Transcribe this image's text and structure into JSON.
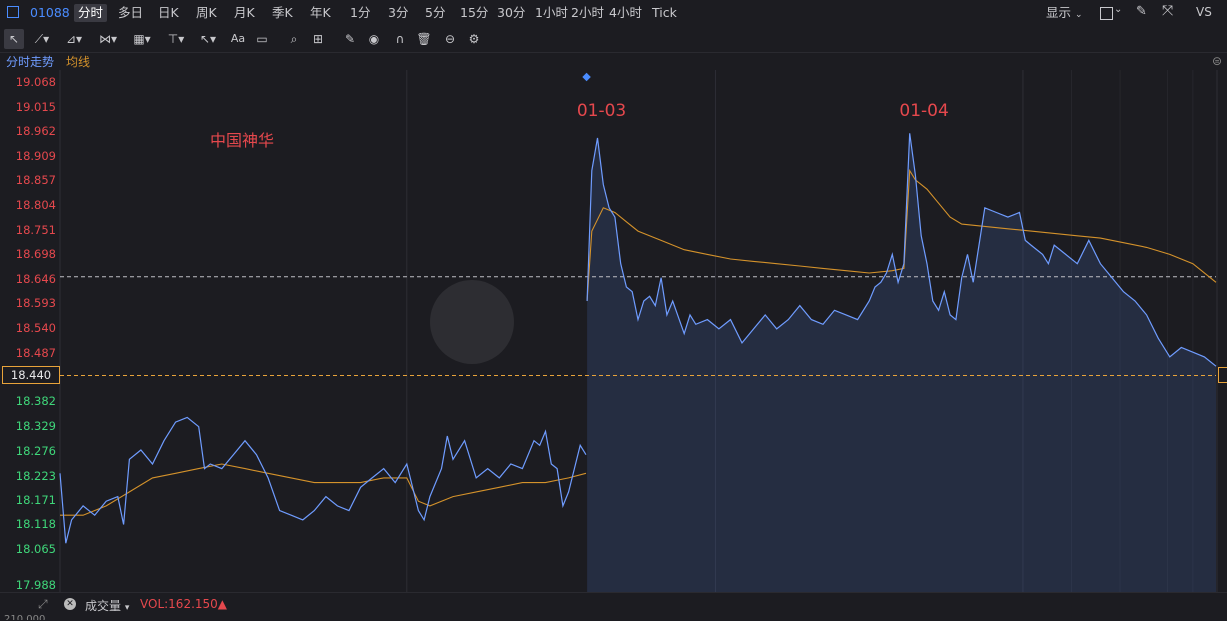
{
  "header": {
    "symbol": "01088",
    "tabs": [
      "分时",
      "多日",
      "日K",
      "周K",
      "月K",
      "季K",
      "年K",
      "1分",
      "3分",
      "5分",
      "15分",
      "30分",
      "1小时",
      "2小时",
      "4小时",
      "Tick"
    ],
    "active_tab": "分时",
    "display_label": "显示",
    "right_code": "VS"
  },
  "legend": {
    "series1": "分时走势",
    "series2": "均线"
  },
  "bottom": {
    "indicator": "成交量",
    "vol_text": "VOL:162.150▲",
    "bottom_cut_value": "210,000"
  },
  "colors": {
    "up": "#e5484d",
    "down": "#3fd77a",
    "price_line": "#6f9cff",
    "avg_line": "#d4922b",
    "accent": "#4a8cff",
    "current": "#e8a33a"
  },
  "chart_data": {
    "type": "line",
    "title": "中国神华",
    "ylim": [
      17.988,
      19.068
    ],
    "y_ticks": [
      19.068,
      19.015,
      18.962,
      18.909,
      18.857,
      18.804,
      18.751,
      18.698,
      18.646,
      18.593,
      18.54,
      18.487,
      18.44,
      18.382,
      18.329,
      18.276,
      18.223,
      18.171,
      18.118,
      18.065,
      17.988
    ],
    "y_tick_labels": [
      "19.068",
      "19.015",
      "18.962",
      "18.909",
      "18.857",
      "18.804",
      "18.751",
      "18.698",
      "18.646",
      "18.593",
      "18.540",
      "18.487",
      "18.440",
      "18.382",
      "18.329",
      "18.276",
      "18.223",
      "18.171",
      "18.118",
      "18.065",
      "17.988"
    ],
    "prev_close": 18.44,
    "prev_close_label": "18.440",
    "reference_line": 18.652,
    "day_labels": [
      "01-03",
      "01-04"
    ],
    "day_boundaries": [
      0.3,
      0.567,
      0.833
    ],
    "series": [
      {
        "name": "分时走势",
        "points": [
          [
            0,
            18.23
          ],
          [
            0.005,
            18.08
          ],
          [
            0.01,
            18.13
          ],
          [
            0.02,
            18.16
          ],
          [
            0.03,
            18.14
          ],
          [
            0.04,
            18.17
          ],
          [
            0.05,
            18.18
          ],
          [
            0.055,
            18.12
          ],
          [
            0.06,
            18.26
          ],
          [
            0.07,
            18.28
          ],
          [
            0.08,
            18.25
          ],
          [
            0.09,
            18.3
          ],
          [
            0.1,
            18.34
          ],
          [
            0.11,
            18.35
          ],
          [
            0.12,
            18.33
          ],
          [
            0.125,
            18.24
          ],
          [
            0.13,
            18.25
          ],
          [
            0.14,
            18.24
          ],
          [
            0.15,
            18.27
          ],
          [
            0.16,
            18.3
          ],
          [
            0.17,
            18.27
          ],
          [
            0.18,
            18.22
          ],
          [
            0.19,
            18.15
          ],
          [
            0.2,
            18.14
          ],
          [
            0.21,
            18.13
          ],
          [
            0.22,
            18.15
          ],
          [
            0.23,
            18.18
          ],
          [
            0.24,
            18.16
          ],
          [
            0.25,
            18.15
          ],
          [
            0.26,
            18.2
          ],
          [
            0.27,
            18.22
          ],
          [
            0.28,
            18.24
          ],
          [
            0.29,
            18.21
          ],
          [
            0.3,
            18.25
          ],
          [
            0.31,
            18.15
          ],
          [
            0.315,
            18.13
          ],
          [
            0.32,
            18.18
          ],
          [
            0.33,
            18.24
          ],
          [
            0.335,
            18.31
          ],
          [
            0.34,
            18.26
          ],
          [
            0.35,
            18.3
          ],
          [
            0.36,
            18.22
          ],
          [
            0.37,
            18.24
          ],
          [
            0.38,
            18.22
          ],
          [
            0.39,
            18.25
          ],
          [
            0.4,
            18.24
          ],
          [
            0.41,
            18.3
          ],
          [
            0.415,
            18.29
          ],
          [
            0.42,
            18.32
          ],
          [
            0.425,
            18.25
          ],
          [
            0.43,
            18.24
          ],
          [
            0.435,
            18.16
          ],
          [
            0.44,
            18.19
          ],
          [
            0.445,
            18.24
          ],
          [
            0.45,
            18.29
          ],
          [
            0.455,
            18.27
          ],
          [
            0.456,
            18.6
          ],
          [
            0.46,
            18.88
          ],
          [
            0.465,
            18.95
          ],
          [
            0.47,
            18.85
          ],
          [
            0.475,
            18.8
          ],
          [
            0.48,
            18.78
          ],
          [
            0.485,
            18.68
          ],
          [
            0.49,
            18.63
          ],
          [
            0.495,
            18.62
          ],
          [
            0.5,
            18.56
          ],
          [
            0.505,
            18.6
          ],
          [
            0.51,
            18.61
          ],
          [
            0.515,
            18.59
          ],
          [
            0.52,
            18.65
          ],
          [
            0.525,
            18.57
          ],
          [
            0.53,
            18.6
          ],
          [
            0.54,
            18.53
          ],
          [
            0.545,
            18.57
          ],
          [
            0.55,
            18.55
          ],
          [
            0.56,
            18.56
          ],
          [
            0.57,
            18.54
          ],
          [
            0.58,
            18.56
          ],
          [
            0.59,
            18.51
          ],
          [
            0.6,
            18.54
          ],
          [
            0.61,
            18.57
          ],
          [
            0.62,
            18.54
          ],
          [
            0.63,
            18.56
          ],
          [
            0.64,
            18.59
          ],
          [
            0.65,
            18.56
          ],
          [
            0.66,
            18.55
          ],
          [
            0.67,
            18.58
          ],
          [
            0.68,
            18.57
          ],
          [
            0.69,
            18.56
          ],
          [
            0.7,
            18.6
          ],
          [
            0.705,
            18.63
          ],
          [
            0.71,
            18.64
          ],
          [
            0.715,
            18.66
          ],
          [
            0.72,
            18.7
          ],
          [
            0.725,
            18.64
          ],
          [
            0.73,
            18.68
          ],
          [
            0.735,
            18.96
          ],
          [
            0.74,
            18.87
          ],
          [
            0.745,
            18.74
          ],
          [
            0.75,
            18.68
          ],
          [
            0.755,
            18.6
          ],
          [
            0.76,
            18.58
          ],
          [
            0.765,
            18.62
          ],
          [
            0.77,
            18.57
          ],
          [
            0.775,
            18.56
          ],
          [
            0.78,
            18.65
          ],
          [
            0.785,
            18.7
          ],
          [
            0.79,
            18.64
          ],
          [
            0.795,
            18.72
          ],
          [
            0.8,
            18.8
          ],
          [
            0.81,
            18.79
          ],
          [
            0.82,
            18.78
          ],
          [
            0.83,
            18.79
          ],
          [
            0.835,
            18.73
          ],
          [
            0.84,
            18.72
          ],
          [
            0.85,
            18.7
          ],
          [
            0.855,
            18.68
          ],
          [
            0.86,
            18.72
          ],
          [
            0.87,
            18.7
          ],
          [
            0.88,
            18.68
          ],
          [
            0.89,
            18.73
          ],
          [
            0.9,
            18.68
          ],
          [
            0.91,
            18.65
          ],
          [
            0.92,
            18.62
          ],
          [
            0.93,
            18.6
          ],
          [
            0.94,
            18.57
          ],
          [
            0.95,
            18.52
          ],
          [
            0.96,
            18.48
          ],
          [
            0.97,
            18.5
          ],
          [
            0.98,
            18.49
          ],
          [
            0.99,
            18.48
          ],
          [
            1.0,
            18.46
          ]
        ]
      },
      {
        "name": "均线",
        "points": [
          [
            0,
            18.14
          ],
          [
            0.02,
            18.14
          ],
          [
            0.04,
            18.16
          ],
          [
            0.06,
            18.19
          ],
          [
            0.08,
            18.22
          ],
          [
            0.1,
            18.23
          ],
          [
            0.12,
            18.24
          ],
          [
            0.14,
            18.25
          ],
          [
            0.16,
            18.24
          ],
          [
            0.18,
            18.23
          ],
          [
            0.2,
            18.22
          ],
          [
            0.22,
            18.21
          ],
          [
            0.24,
            18.21
          ],
          [
            0.26,
            18.21
          ],
          [
            0.28,
            18.22
          ],
          [
            0.3,
            18.22
          ],
          [
            0.31,
            18.17
          ],
          [
            0.32,
            18.16
          ],
          [
            0.34,
            18.18
          ],
          [
            0.36,
            18.19
          ],
          [
            0.38,
            18.2
          ],
          [
            0.4,
            18.21
          ],
          [
            0.42,
            18.21
          ],
          [
            0.44,
            18.22
          ],
          [
            0.455,
            18.23
          ],
          [
            0.456,
            18.6
          ],
          [
            0.46,
            18.75
          ],
          [
            0.47,
            18.8
          ],
          [
            0.48,
            18.79
          ],
          [
            0.49,
            18.77
          ],
          [
            0.5,
            18.75
          ],
          [
            0.52,
            18.73
          ],
          [
            0.54,
            18.71
          ],
          [
            0.56,
            18.7
          ],
          [
            0.58,
            18.69
          ],
          [
            0.6,
            18.685
          ],
          [
            0.62,
            18.68
          ],
          [
            0.64,
            18.675
          ],
          [
            0.66,
            18.67
          ],
          [
            0.68,
            18.665
          ],
          [
            0.7,
            18.66
          ],
          [
            0.72,
            18.665
          ],
          [
            0.73,
            18.67
          ],
          [
            0.735,
            18.88
          ],
          [
            0.74,
            18.86
          ],
          [
            0.75,
            18.84
          ],
          [
            0.76,
            18.81
          ],
          [
            0.77,
            18.78
          ],
          [
            0.78,
            18.765
          ],
          [
            0.8,
            18.76
          ],
          [
            0.82,
            18.755
          ],
          [
            0.84,
            18.75
          ],
          [
            0.86,
            18.745
          ],
          [
            0.88,
            18.74
          ],
          [
            0.9,
            18.735
          ],
          [
            0.92,
            18.725
          ],
          [
            0.94,
            18.715
          ],
          [
            0.96,
            18.7
          ],
          [
            0.98,
            18.68
          ],
          [
            1.0,
            18.64
          ]
        ]
      }
    ]
  }
}
